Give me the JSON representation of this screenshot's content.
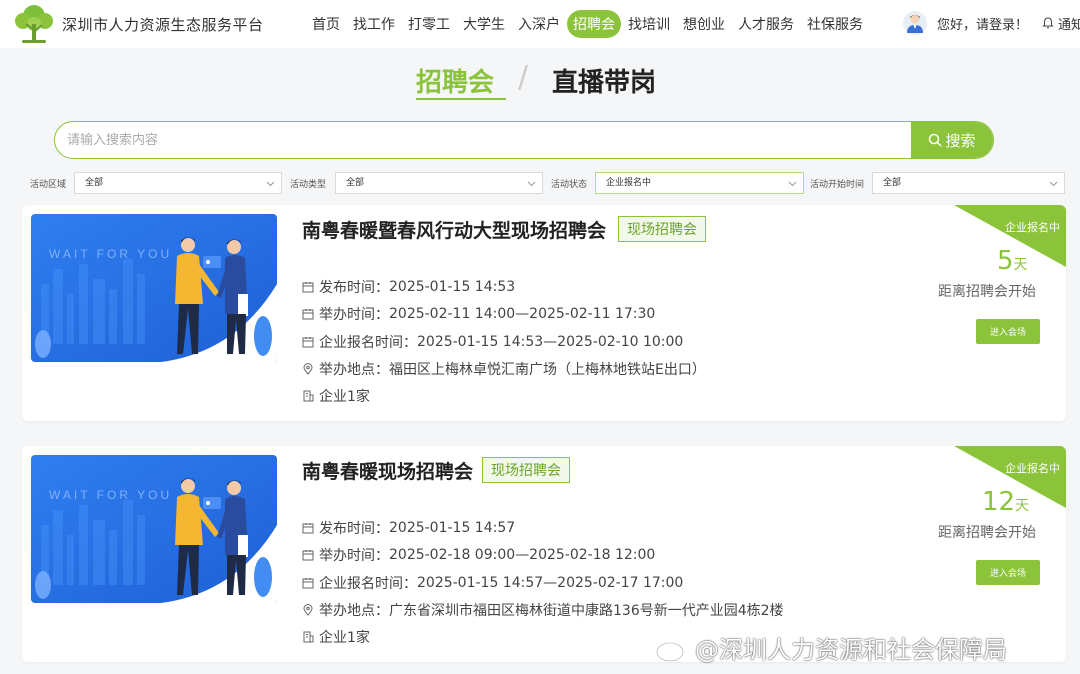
{
  "site": {
    "logo_text": "深圳市人力资源生态服务平台"
  },
  "nav": {
    "items": [
      {
        "label": "首页"
      },
      {
        "label": "找工作"
      },
      {
        "label": "打零工"
      },
      {
        "label": "大学生"
      },
      {
        "label": "入深户"
      },
      {
        "label": "招聘会",
        "active": true
      },
      {
        "label": "找培训"
      },
      {
        "label": "想创业"
      },
      {
        "label": "人才服务"
      },
      {
        "label": "社保服务"
      }
    ],
    "login_text": "您好，请登录！",
    "notice_text": "通知"
  },
  "tabs": {
    "recruit": "招聘会",
    "separator": "/",
    "live": "直播带岗"
  },
  "search": {
    "placeholder": "请输入搜索内容",
    "button_label": "搜索"
  },
  "filters": [
    {
      "label": "活动区域",
      "value": "全部"
    },
    {
      "label": "活动类型",
      "value": "全部"
    },
    {
      "label": "活动状态",
      "value": "企业报名中"
    },
    {
      "label": "活动开始时间",
      "value": "全部"
    }
  ],
  "image_caption": "WAIT FOR YOU",
  "fairs": [
    {
      "title": "南粤春暖暨春风行动大型现场招聘会",
      "tag": "现场招聘会",
      "publish_label": "发布时间：",
      "publish_time": "2025-01-15 14:53",
      "hold_label": "举办时间：",
      "hold_time": "2025-02-11 14:00—2025-02-11 17:30",
      "signup_label": "企业报名时间：",
      "signup_time": "2025-01-15 14:53—2025-02-10 10:00",
      "location_label": "举办地点：",
      "location": "福田区上梅林卓悦汇南广场（上梅林地铁站E出口）",
      "companies": "企业1家",
      "status": "企业报名中",
      "days": "5",
      "days_unit": "天",
      "countdown_label": "距离招聘会开始",
      "button_label": "进入会场"
    },
    {
      "title": "南粤春暖现场招聘会",
      "tag": "现场招聘会",
      "publish_label": "发布时间：",
      "publish_time": "2025-01-15 14:57",
      "hold_label": "举办时间：",
      "hold_time": "2025-02-18 09:00—2025-02-18 12:00",
      "signup_label": "企业报名时间：",
      "signup_time": "2025-01-15 14:57—2025-02-17 17:00",
      "location_label": "举办地点：",
      "location": "广东省深圳市福田区梅林街道中康路136号新一代产业园4栋2楼",
      "companies": "企业1家",
      "status": "企业报名中",
      "days": "12",
      "days_unit": "天",
      "countdown_label": "距离招聘会开始",
      "button_label": "进入会场"
    }
  ],
  "watermark": "@深圳人力资源和社会保障局",
  "colors": {
    "accent": "#8bc43a",
    "accent_dark": "#6aa52a",
    "image_blue": "#2f7ff0"
  }
}
